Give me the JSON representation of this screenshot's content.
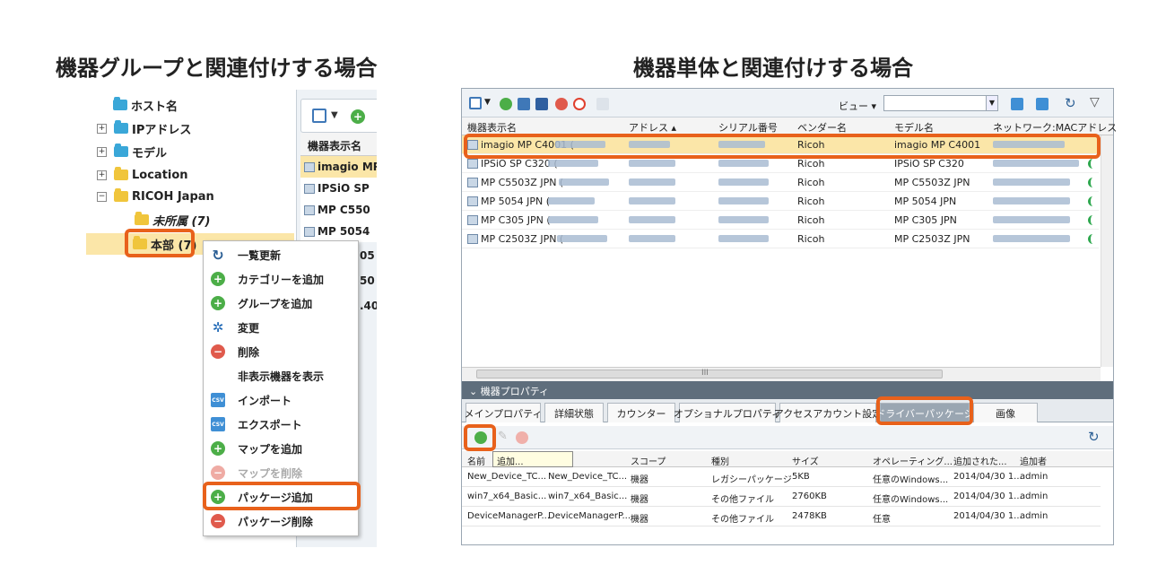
{
  "headlines": {
    "left": "機器グループと関連付けする場合",
    "right": "機器単体と関連付けする場合"
  },
  "left_panel": {
    "tree": [
      {
        "label": "ホスト名",
        "folder": "blue",
        "expander": ""
      },
      {
        "label": "IPアドレス",
        "folder": "blue",
        "expander": "+"
      },
      {
        "label": "モデル",
        "folder": "blue",
        "expander": "+"
      },
      {
        "label": "Location",
        "folder": "yellow",
        "expander": "+"
      },
      {
        "label": "RICOH Japan",
        "folder": "yellow",
        "expander": "−"
      },
      {
        "label": "未所属 (7)",
        "folder": "yellow",
        "expander": ""
      },
      {
        "label": "本部 (7)",
        "folder": "yellow",
        "expander": ""
      }
    ],
    "list": {
      "header": "機器表示名",
      "rows": [
        "imagio MP",
        "IPSiO SP",
        "MP C550",
        "MP 5054",
        "05",
        "50",
        ".40"
      ]
    },
    "context_menu": [
      {
        "label": "一覧更新",
        "icon": "refresh-icon"
      },
      {
        "label": "カテゴリーを追加",
        "icon": "add-icon"
      },
      {
        "label": "グループを追加",
        "icon": "add-icon"
      },
      {
        "label": "変更",
        "icon": "gear-icon"
      },
      {
        "label": "削除",
        "icon": "remove-icon"
      },
      {
        "label": "非表示機器を表示",
        "icon": ""
      },
      {
        "label": "インポート",
        "icon": "csv-import-icon"
      },
      {
        "label": "エクスポート",
        "icon": "csv-export-icon"
      },
      {
        "label": "マップを追加",
        "icon": "add-icon"
      },
      {
        "label": "マップを削除",
        "icon": "remove-icon",
        "disabled": true
      },
      {
        "label": "パッケージ追加",
        "icon": "add-icon"
      },
      {
        "label": "パッケージ削除",
        "icon": "remove-icon"
      }
    ]
  },
  "right_panel": {
    "toolbar": {
      "view_label": "ビュー ▾"
    },
    "columns": [
      "機器表示名",
      "アドレス ▴",
      "シリアル番号",
      "ベンダー名",
      "モデル名",
      "ネットワーク:MACアドレス"
    ],
    "rows": [
      {
        "name": "imagio MP C4001 (",
        "vendor": "Ricoh",
        "model": "imagio MP C4001"
      },
      {
        "name": "IPSiO SP C320 (",
        "vendor": "Ricoh",
        "model": "IPSiO SP C320"
      },
      {
        "name": "MP C5503Z JPN (",
        "vendor": "Ricoh",
        "model": "MP C5503Z JPN"
      },
      {
        "name": "MP 5054 JPN (",
        "vendor": "Ricoh",
        "model": "MP 5054 JPN"
      },
      {
        "name": "MP C305 JPN (",
        "vendor": "Ricoh",
        "model": "MP C305 JPN"
      },
      {
        "name": "MP C2503Z JPN (",
        "vendor": "Ricoh",
        "model": "MP C2503Z JPN"
      }
    ],
    "hscroll_label": "III",
    "properties_title": "機器プロパティ",
    "tabs": [
      "メインプロパティ",
      "詳細状態",
      "カウンター",
      "オプショナルプロパティ",
      "アクセスアカウント設定",
      "ドライバーパッケージ",
      "画像"
    ],
    "tooltip": "追加...",
    "package_columns": [
      "名前",
      "スコープ",
      "種別",
      "サイズ",
      "オペレーティング...",
      "追加された...",
      "追加者"
    ],
    "packages": [
      {
        "name": "New_Device_TC...",
        "file": "New_Device_TC...",
        "scope": "機器",
        "type": "レガシーパッケージ",
        "size": "5KB",
        "os": "任意のWindows...",
        "added": "2014/04/30 1...",
        "by": "admin"
      },
      {
        "name": "win7_x64_Basic...",
        "file": "win7_x64_Basic...",
        "scope": "機器",
        "type": "その他ファイル",
        "size": "2760KB",
        "os": "任意のWindows...",
        "added": "2014/04/30 1...",
        "by": "admin"
      },
      {
        "name": "DeviceManagerP...",
        "file": "DeviceManagerP...",
        "scope": "機器",
        "type": "その他ファイル",
        "size": "2478KB",
        "os": "任意",
        "added": "2014/04/30 1...",
        "by": "admin"
      }
    ]
  },
  "colors": {
    "highlight": "#e8611b",
    "selection": "#fbe6a8"
  }
}
